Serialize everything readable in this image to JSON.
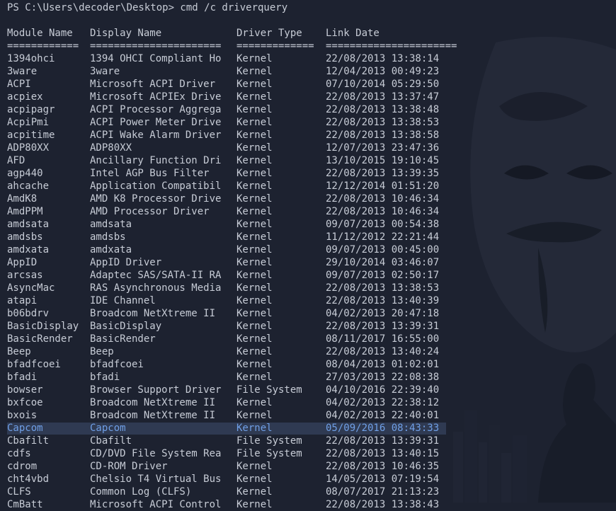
{
  "colors": {
    "background": "#1d2230",
    "text": "#c7ccd6",
    "selection_bg": "#2f3a52",
    "selection_text": "#6f9fe6"
  },
  "prompt": "PS C:\\Users\\decoder\\Desktop> cmd /c driverquery",
  "headers": [
    "Module Name",
    "Display Name",
    "Driver Type",
    "Link Date"
  ],
  "separators": [
    "============",
    "======================",
    "=============",
    "======================"
  ],
  "selected_index": 29,
  "rows": [
    [
      "1394ohci",
      "1394 OHCI Compliant Ho",
      "Kernel",
      "22/08/2013 13:38:14"
    ],
    [
      "3ware",
      "3ware",
      "Kernel",
      "12/04/2013 00:49:23"
    ],
    [
      "ACPI",
      "Microsoft ACPI Driver",
      "Kernel",
      "07/10/2014 05:29:50"
    ],
    [
      "acpiex",
      "Microsoft ACPIEx Drive",
      "Kernel",
      "22/08/2013 13:37:47"
    ],
    [
      "acpipagr",
      "ACPI Processor Aggrega",
      "Kernel",
      "22/08/2013 13:38:48"
    ],
    [
      "AcpiPmi",
      "ACPI Power Meter Drive",
      "Kernel",
      "22/08/2013 13:38:53"
    ],
    [
      "acpitime",
      "ACPI Wake Alarm Driver",
      "Kernel",
      "22/08/2013 13:38:58"
    ],
    [
      "ADP80XX",
      "ADP80XX",
      "Kernel",
      "12/07/2013 23:47:36"
    ],
    [
      "AFD",
      "Ancillary Function Dri",
      "Kernel",
      "13/10/2015 19:10:45"
    ],
    [
      "agp440",
      "Intel AGP Bus Filter",
      "Kernel",
      "22/08/2013 13:39:35"
    ],
    [
      "ahcache",
      "Application Compatibil",
      "Kernel",
      "12/12/2014 01:51:20"
    ],
    [
      "AmdK8",
      "AMD K8 Processor Drive",
      "Kernel",
      "22/08/2013 10:46:34"
    ],
    [
      "AmdPPM",
      "AMD Processor Driver",
      "Kernel",
      "22/08/2013 10:46:34"
    ],
    [
      "amdsata",
      "amdsata",
      "Kernel",
      "09/07/2013 00:54:38"
    ],
    [
      "amdsbs",
      "amdsbs",
      "Kernel",
      "11/12/2012 22:21:44"
    ],
    [
      "amdxata",
      "amdxata",
      "Kernel",
      "09/07/2013 00:45:00"
    ],
    [
      "AppID",
      "AppID Driver",
      "Kernel",
      "29/10/2014 03:46:07"
    ],
    [
      "arcsas",
      "Adaptec SAS/SATA-II RA",
      "Kernel",
      "09/07/2013 02:50:17"
    ],
    [
      "AsyncMac",
      "RAS Asynchronous Media",
      "Kernel",
      "22/08/2013 13:38:53"
    ],
    [
      "atapi",
      "IDE Channel",
      "Kernel",
      "22/08/2013 13:40:39"
    ],
    [
      "b06bdrv",
      "Broadcom NetXtreme II",
      "Kernel",
      "04/02/2013 20:47:18"
    ],
    [
      "BasicDisplay",
      "BasicDisplay",
      "Kernel",
      "22/08/2013 13:39:31"
    ],
    [
      "BasicRender",
      "BasicRender",
      "Kernel",
      "08/11/2017 16:55:00"
    ],
    [
      "Beep",
      "Beep",
      "Kernel",
      "22/08/2013 13:40:24"
    ],
    [
      "bfadfcoei",
      "bfadfcoei",
      "Kernel",
      "08/04/2013 01:02:01"
    ],
    [
      "bfadi",
      "bfadi",
      "Kernel",
      "27/03/2013 22:08:38"
    ],
    [
      "bowser",
      "Browser Support Driver",
      "File System",
      "04/10/2016 22:39:40"
    ],
    [
      "bxfcoe",
      "Broadcom NetXtreme II",
      "Kernel",
      "04/02/2013 22:38:12"
    ],
    [
      "bxois",
      "Broadcom NetXtreme II",
      "Kernel",
      "04/02/2013 22:40:01"
    ],
    [
      "Capcom",
      "Capcom",
      "Kernel",
      "05/09/2016 08:43:33"
    ],
    [
      "Cbafilt",
      "Cbafilt",
      "File System",
      "22/08/2013 13:39:31"
    ],
    [
      "cdfs",
      "CD/DVD File System Rea",
      "File System",
      "22/08/2013 13:40:15"
    ],
    [
      "cdrom",
      "CD-ROM Driver",
      "Kernel",
      "22/08/2013 10:46:35"
    ],
    [
      "cht4vbd",
      "Chelsio T4 Virtual Bus",
      "Kernel",
      "14/05/2013 07:19:54"
    ],
    [
      "CLFS",
      "Common Log (CLFS)",
      "Kernel",
      "08/07/2017 21:13:23"
    ],
    [
      "CmBatt",
      "Microsoft ACPI Control",
      "Kernel",
      "22/08/2013 13:38:43"
    ]
  ]
}
